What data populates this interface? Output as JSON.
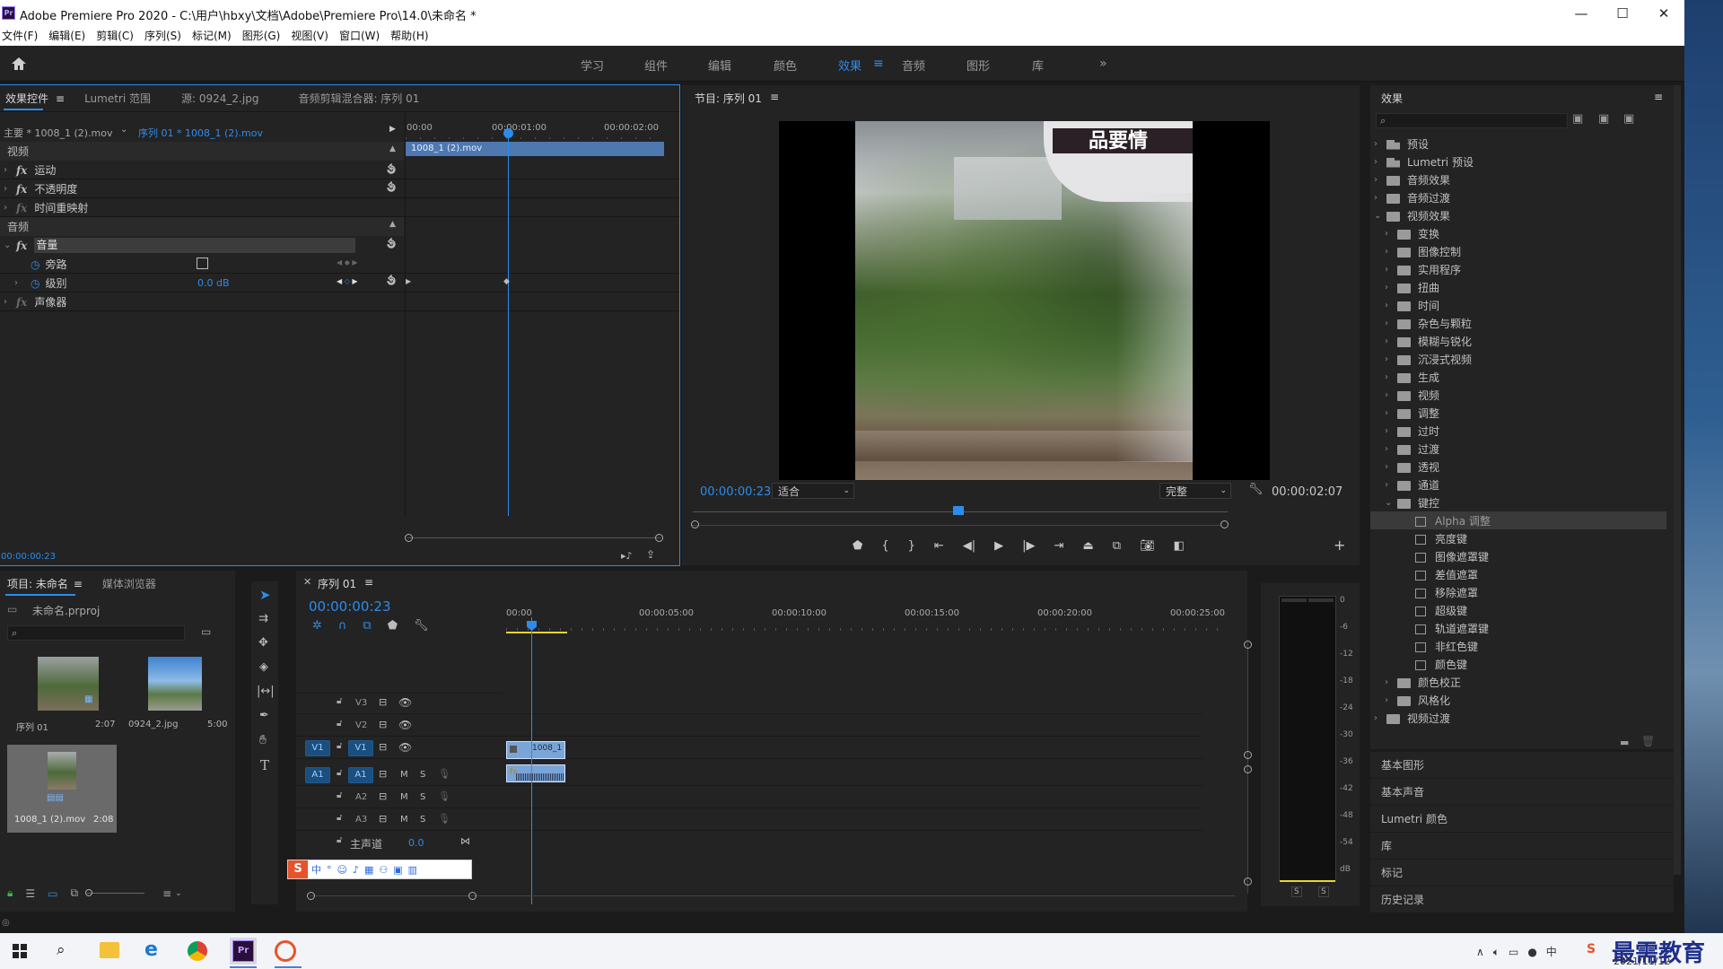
{
  "window": {
    "title": "Adobe Premiere Pro 2020 - C:\\用户\\hbxy\\文档\\Adobe\\Premiere Pro\\14.0\\未命名 *",
    "logo": "Pr"
  },
  "menu": [
    "文件(F)",
    "编辑(E)",
    "剪辑(C)",
    "序列(S)",
    "标记(M)",
    "图形(G)",
    "视图(V)",
    "窗口(W)",
    "帮助(H)"
  ],
  "workspaces": [
    "学习",
    "组件",
    "编辑",
    "颜色",
    "效果",
    "音频",
    "图形",
    "库"
  ],
  "workspace_active": "效果",
  "effect_controls": {
    "tabs": [
      "效果控件",
      "Lumetri 范围",
      "源: 0924_2.jpg",
      "音频剪辑混合器: 序列 01"
    ],
    "master": "主要 * 1008_1 (2).mov",
    "sequence": "序列 01 * 1008_1 (2).mov",
    "ruler": [
      "00:00",
      "00:00:01:00",
      "00:00:02:00"
    ],
    "clip": "1008_1 (2).mov",
    "video_header": "视频",
    "video_items": [
      "运动",
      "不透明度",
      "时间重映射"
    ],
    "audio_header": "音频",
    "volume": "音量",
    "bypass": "旁路",
    "level": "级别",
    "level_value": "0.0 dB",
    "panner": "声像器",
    "timecode": "00:00:00:23"
  },
  "program": {
    "title": "节目: 序列 01",
    "timecode": "00:00:00:23",
    "fit": "适合",
    "quality": "完整",
    "duration": "00:00:02:07",
    "overlay_text": "品要情"
  },
  "effects": {
    "title": "效果",
    "top_items": [
      {
        "label": "预设",
        "type": "preset"
      },
      {
        "label": "Lumetri 预设",
        "type": "preset"
      },
      {
        "label": "音频效果",
        "type": "folder"
      },
      {
        "label": "音频过渡",
        "type": "folder"
      },
      {
        "label": "视频效果",
        "type": "folder",
        "open": true
      }
    ],
    "video_effects": [
      "变换",
      "图像控制",
      "实用程序",
      "扭曲",
      "时间",
      "杂色与颗粒",
      "模糊与锐化",
      "沉浸式视频",
      "生成",
      "视频",
      "调整",
      "过时",
      "过渡",
      "透视",
      "通道",
      "键控"
    ],
    "keying": [
      "Alpha 调整",
      "亮度键",
      "图像遮罩键",
      "差值遮罩",
      "移除遮罩",
      "超级键",
      "轨道遮罩键",
      "非红色键",
      "颜色键"
    ],
    "after_keying": [
      "颜色校正",
      "风格化"
    ],
    "video_transitions": "视频过渡",
    "sections": [
      "基本图形",
      "基本声音",
      "Lumetri 颜色",
      "库",
      "标记",
      "历史记录"
    ]
  },
  "project": {
    "tabs": [
      "项目: 未命名",
      "媒体浏览器"
    ],
    "file": "未命名.prproj",
    "items": [
      {
        "name": "序列 01",
        "duration": "2:07"
      },
      {
        "name": "0924_2.jpg",
        "duration": "5:00"
      },
      {
        "name": "1008_1 (2).mov",
        "duration": "2:08"
      }
    ]
  },
  "timeline": {
    "title": "序列 01",
    "timecode": "00:00:00:23",
    "ruler": [
      "00:00",
      "00:00:05:00",
      "00:00:10:00",
      "00:00:15:00",
      "00:00:20:00",
      "00:00:25:00"
    ],
    "tracks_video": [
      "V3",
      "V2",
      "V1"
    ],
    "tracks_audio": [
      "A1",
      "A2",
      "A3"
    ],
    "source_v": "V1",
    "source_a": "A1",
    "mute": "M",
    "solo": "S",
    "master": "主声道",
    "master_value": "0.0",
    "clip_label": "1008_1"
  },
  "meter": {
    "scale": [
      "0",
      "-6",
      "-12",
      "-18",
      "-24",
      "-30",
      "-36",
      "-42",
      "-48",
      "-54",
      "dB"
    ],
    "solo_labels": [
      "S",
      "S"
    ]
  },
  "taskbar": {
    "date": "2021/11/12",
    "watermark": "最需教育"
  }
}
